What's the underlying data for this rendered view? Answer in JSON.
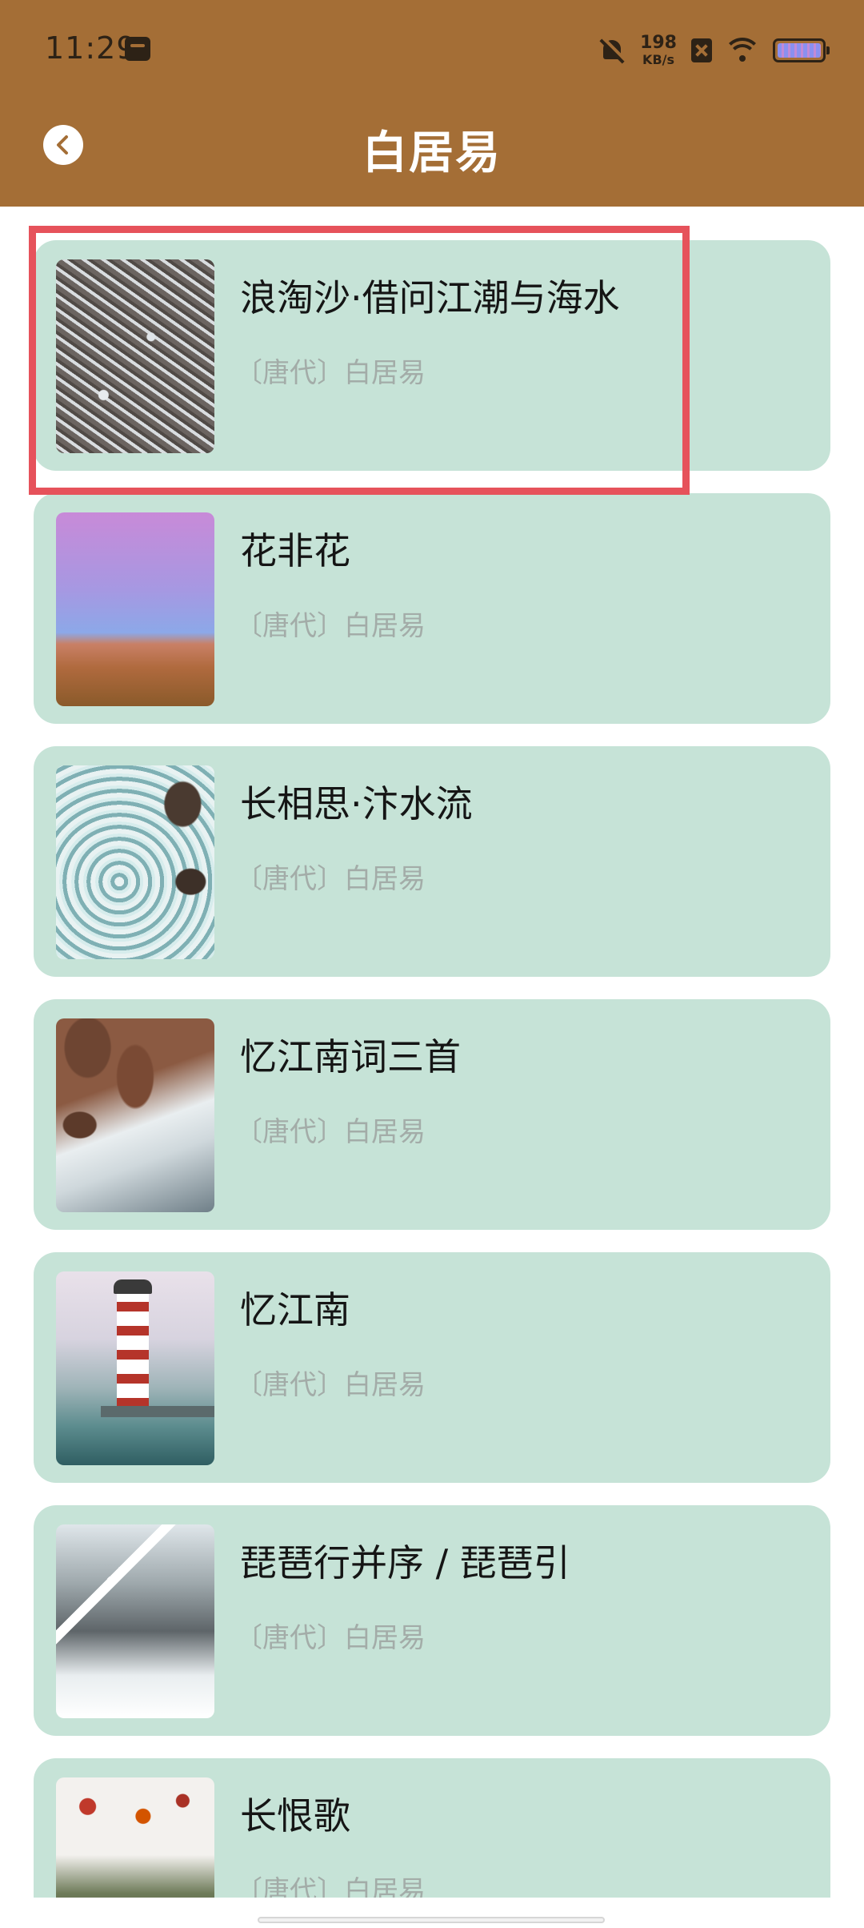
{
  "status_bar": {
    "time": "11:29",
    "net_speed_value": "198",
    "net_speed_unit": "KB/s",
    "icons": [
      "notification-app-icon",
      "mute-icon",
      "sim-off-icon",
      "wifi-icon",
      "battery-icon"
    ]
  },
  "header": {
    "title": "白居易",
    "back_icon": "chevron-left-icon"
  },
  "colors": {
    "header_bg": "#a46e36",
    "card_bg": "#c6e3d7",
    "highlight": "#e6525b",
    "meta_text": "#a3aca8"
  },
  "poems": [
    {
      "title": "浪淘沙·借问江潮与海水",
      "dynasty": "〔唐代〕",
      "author": "白居易"
    },
    {
      "title": "花非花",
      "dynasty": "〔唐代〕",
      "author": "白居易"
    },
    {
      "title": "长相思·汴水流",
      "dynasty": "〔唐代〕",
      "author": "白居易"
    },
    {
      "title": "忆江南词三首",
      "dynasty": "〔唐代〕",
      "author": "白居易"
    },
    {
      "title": "忆江南",
      "dynasty": "〔唐代〕",
      "author": "白居易"
    },
    {
      "title": "琵琶行并序 / 琵琶引",
      "dynasty": "〔唐代〕",
      "author": "白居易"
    },
    {
      "title": "长恨歌",
      "dynasty": "〔唐代〕",
      "author": "白居易"
    }
  ]
}
